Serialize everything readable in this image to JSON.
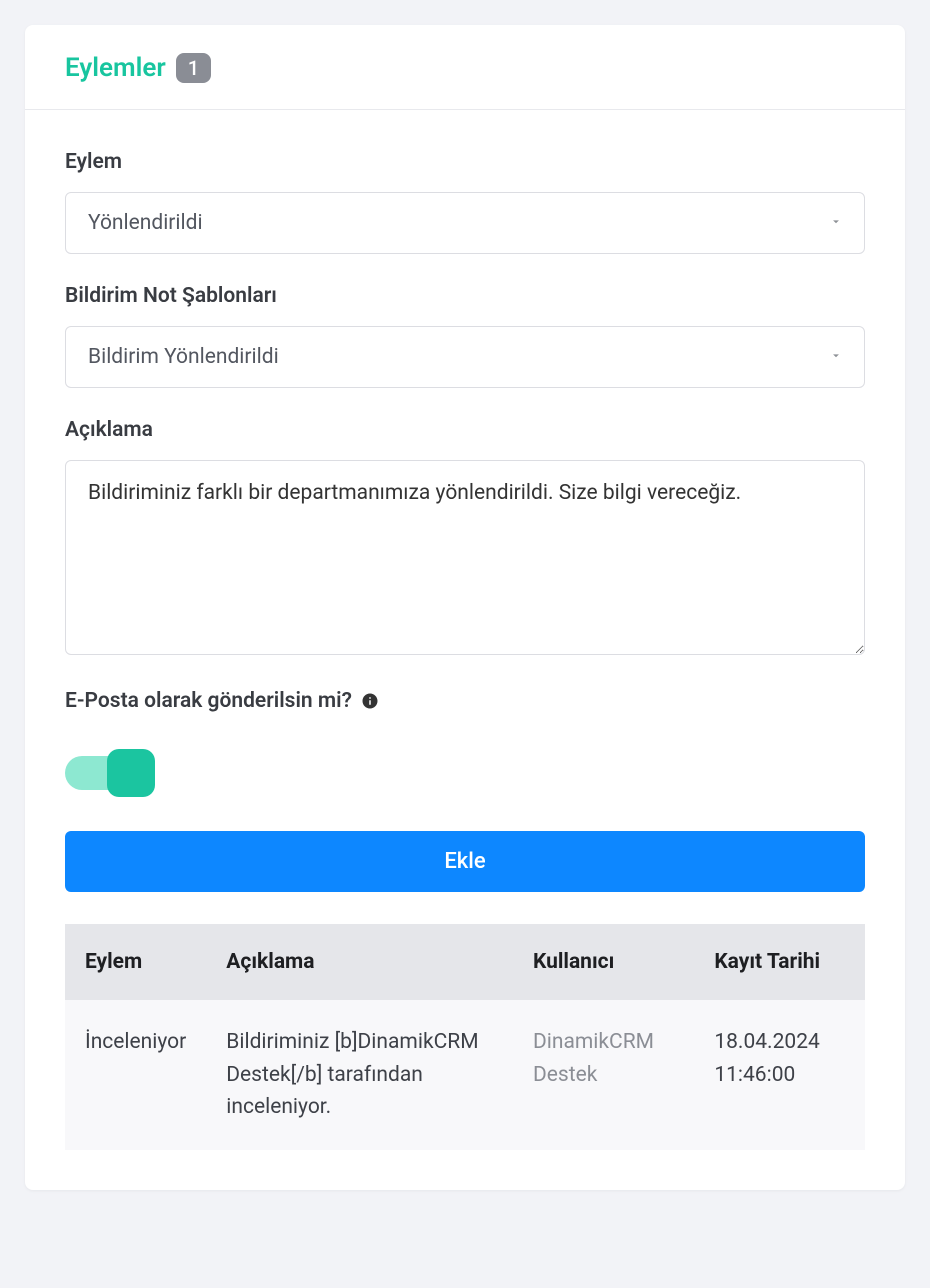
{
  "header": {
    "title": "Eylemler",
    "count": "1"
  },
  "form": {
    "action": {
      "label": "Eylem",
      "value": "Yönlendirildi"
    },
    "template": {
      "label": "Bildirim Not Şablonları",
      "value": "Bildirim Yönlendirildi"
    },
    "description": {
      "label": "Açıklama",
      "value": "Bildiriminiz farklı bir departmanımıza yönlendirildi. Size bilgi vereceğiz."
    },
    "email": {
      "label": "E-Posta olarak gönderilsin mi?"
    },
    "submit_label": "Ekle"
  },
  "table": {
    "headers": {
      "action": "Eylem",
      "description": "Açıklama",
      "user": "Kullanıcı",
      "date": "Kayıt Tarihi"
    },
    "rows": [
      {
        "action": "İnceleniyor",
        "description": "Bildiriminiz [b]DinamikCRM Destek[/b] tarafından inceleniyor.",
        "user": "DinamikCRM Destek",
        "date": "18.04.2024 11:46:00"
      }
    ]
  }
}
